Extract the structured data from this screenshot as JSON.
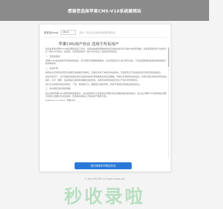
{
  "header": {
    "title": "感谢您选择苹果CMS-V10系统建网站"
  },
  "language": {
    "label": "语言包[lang]:",
    "selected": "zh-cn",
    "hint": "提示：默认后台及前台使用的语言包"
  },
  "agreement": {
    "title": "苹果CMS用户协议 适用于所有用户",
    "paragraphs": [
      "请您在使用(苹果CMS)前仔细阅读如下条款。包括免除或者限制作者责任的免责条款及对用户的权利限制。您的安装使用行为将视为对《用户许可协议》的接受，并同意接受本《用户许可协议》各项条款的约束。",
      "一、安装和使用：",
      "(苹果CMS)是免费和开源提供给您的，您可安装无限制数量副本。您必须保证在不进行非法活动，不违反国家相关政策法规的前提下使用本软件。",
      "二、免责声明：",
      "本软件并无附带任何形式的明示的或暗示的保证，包括任何关于本软件的适用性，无侵犯知识产权或适合作为特定用途的保证。",
      "在任何情况下，对于因使用本软件或无法使用本软件而导致的任何损害赔偿，作者均无须承担法律责任。作者不保证本软件所包含的资料、文字、图形、链接或其它事项的准确性或完整性。本软件的所有版权及知识产权均归作者所有。",
      "用户在对本软件的任何修改、下载、使用等行为，都需自行承担风险，作者不承担任何因此造成的损失。",
      "三、协议规定的约束和限制：",
      "禁止去除(苹果CMS)源码里的版权信息，商业授权用户可去除后台界面及前台界面的相关版权信息。禁止在(苹果CMS)整体或任何部分基础上发展任何派生版本、修改版本或第三方版本用于重新分发。",
      "Published on 2019 - 苹果CMS"
    ],
    "agree_button": "我已阅读并同意此协议"
  },
  "footer": {
    "copyright": "© MacCMS.PRO All Rights Reserved"
  },
  "watermark": {
    "text": "秒收录啦"
  }
}
